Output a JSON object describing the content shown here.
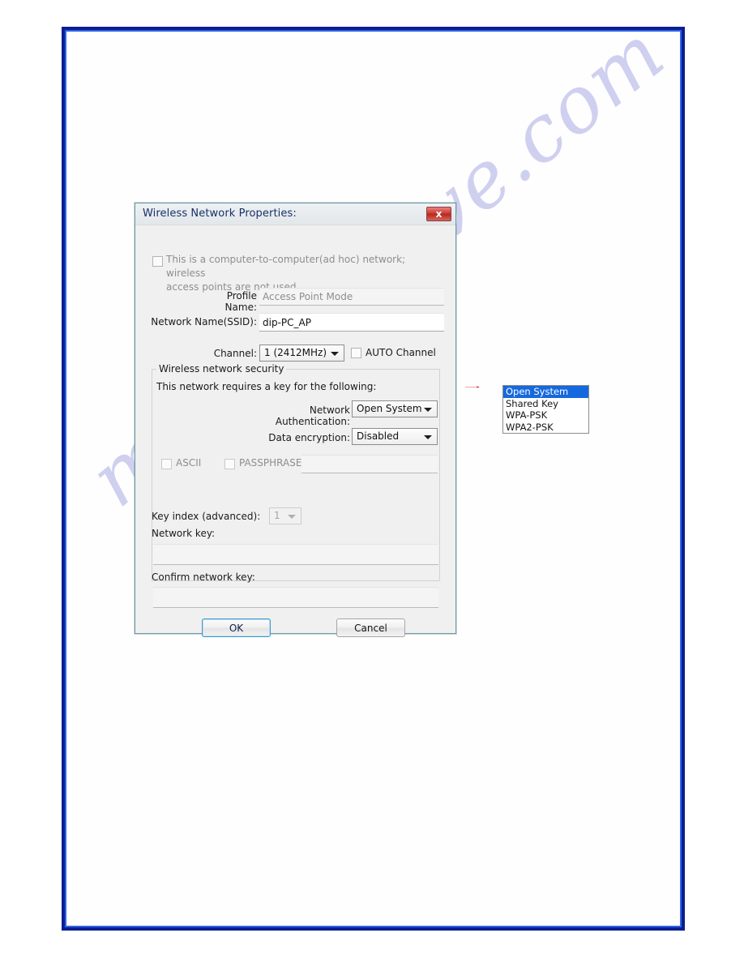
{
  "page": {
    "watermark_text": "manualshive.com",
    "border_color_outer": "#0b1f8f",
    "border_color_inner": "#2f63e8"
  },
  "dialog": {
    "title": "Wireless Network Properties:",
    "close_label": "x",
    "adhoc_checkbox": {
      "line1": "This is a computer-to-computer(ad hoc) network; wireless",
      "line2": "access points are not used.",
      "checked": false,
      "enabled": false
    },
    "profile_name": {
      "label": "Profile Name:",
      "value": "Access Point Mode",
      "enabled": false
    },
    "ssid": {
      "label": "Network Name(SSID):",
      "value": "dip-PC_AP",
      "enabled": true
    },
    "channel": {
      "label": "Channel:",
      "value": "1  (2412MHz)",
      "auto_label": "AUTO Channel",
      "auto_checked": false
    },
    "security_group": {
      "legend": "Wireless network security",
      "description": "This network requires a key for the following:",
      "network_authentication": {
        "label": "Network Authentication:",
        "value": "Open System"
      },
      "data_encryption": {
        "label": "Data encryption:",
        "value": "Disabled"
      },
      "ascii": {
        "label": "ASCII",
        "checked": false,
        "enabled": false
      },
      "passphrase": {
        "label": "PASSPHRASE",
        "checked": false,
        "enabled": false
      },
      "passphrase_value": "",
      "key_index": {
        "label": "Key index (advanced):",
        "value": "1",
        "enabled": false
      },
      "network_key": {
        "label": "Network key:",
        "value": ""
      },
      "confirm_network_key": {
        "label": "Confirm network key:",
        "value": ""
      }
    },
    "buttons": {
      "ok": "OK",
      "cancel": "Cancel"
    }
  },
  "dropdown": {
    "accent_color": "#1569de",
    "options": [
      {
        "label": "Open System",
        "selected": true
      },
      {
        "label": "Shared Key",
        "selected": false
      },
      {
        "label": "WPA-PSK",
        "selected": false
      },
      {
        "label": "WPA2-PSK",
        "selected": false
      }
    ]
  },
  "callout": {
    "arrow_color": "#e01b14"
  }
}
